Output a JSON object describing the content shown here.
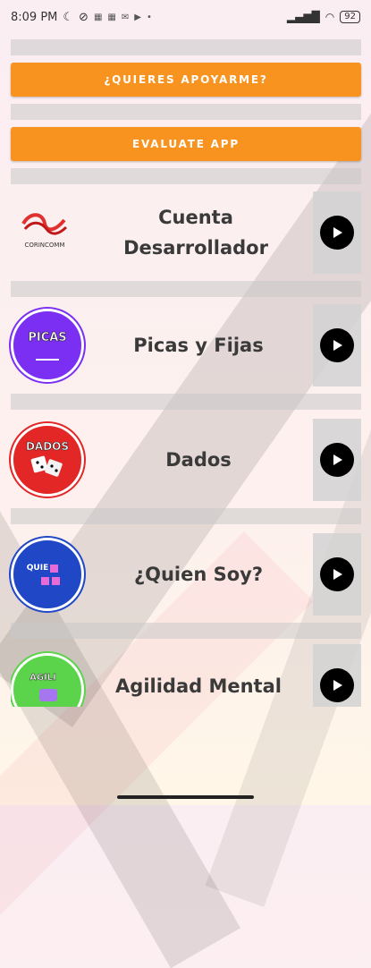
{
  "status_bar": {
    "time": "8:09 PM",
    "icons_left": [
      "moon-icon",
      "data-saver-icon",
      "notification-icon",
      "notification-icon",
      "mail-icon",
      "play-icon"
    ],
    "battery": "92"
  },
  "buttons": {
    "support": "¿QUIERES APOYARME?",
    "rate": "EVALUATE APP"
  },
  "items": [
    {
      "title_line1": "Cuenta",
      "title_line2": "Desarrollador",
      "logo_icon": "developer-logo-icon",
      "logo_text": "CORINCOMM",
      "logo_color": "#ffffff"
    },
    {
      "title_line1": "Picas y Fijas",
      "title_line2": "",
      "logo_icon": "picas-logo-icon",
      "logo_text": "PICAS",
      "logo_color": "#7b2ff2"
    },
    {
      "title_line1": "Dados",
      "title_line2": "",
      "logo_icon": "dados-logo-icon",
      "logo_text": "DADOS",
      "logo_color": "#e32626"
    },
    {
      "title_line1": "¿Quien Soy?",
      "title_line2": "",
      "logo_icon": "quien-logo-icon",
      "logo_text": "QUIE",
      "logo_color": "#1f47c6"
    },
    {
      "title_line1": "Agilidad Mental",
      "title_line2": "",
      "logo_icon": "agilidad-logo-icon",
      "logo_text": "AGILI",
      "logo_color": "#5bd44c"
    }
  ],
  "colors": {
    "orange": "#f7931e",
    "strip": "#c8c8c8",
    "play_bg": "#d2d2d2"
  }
}
